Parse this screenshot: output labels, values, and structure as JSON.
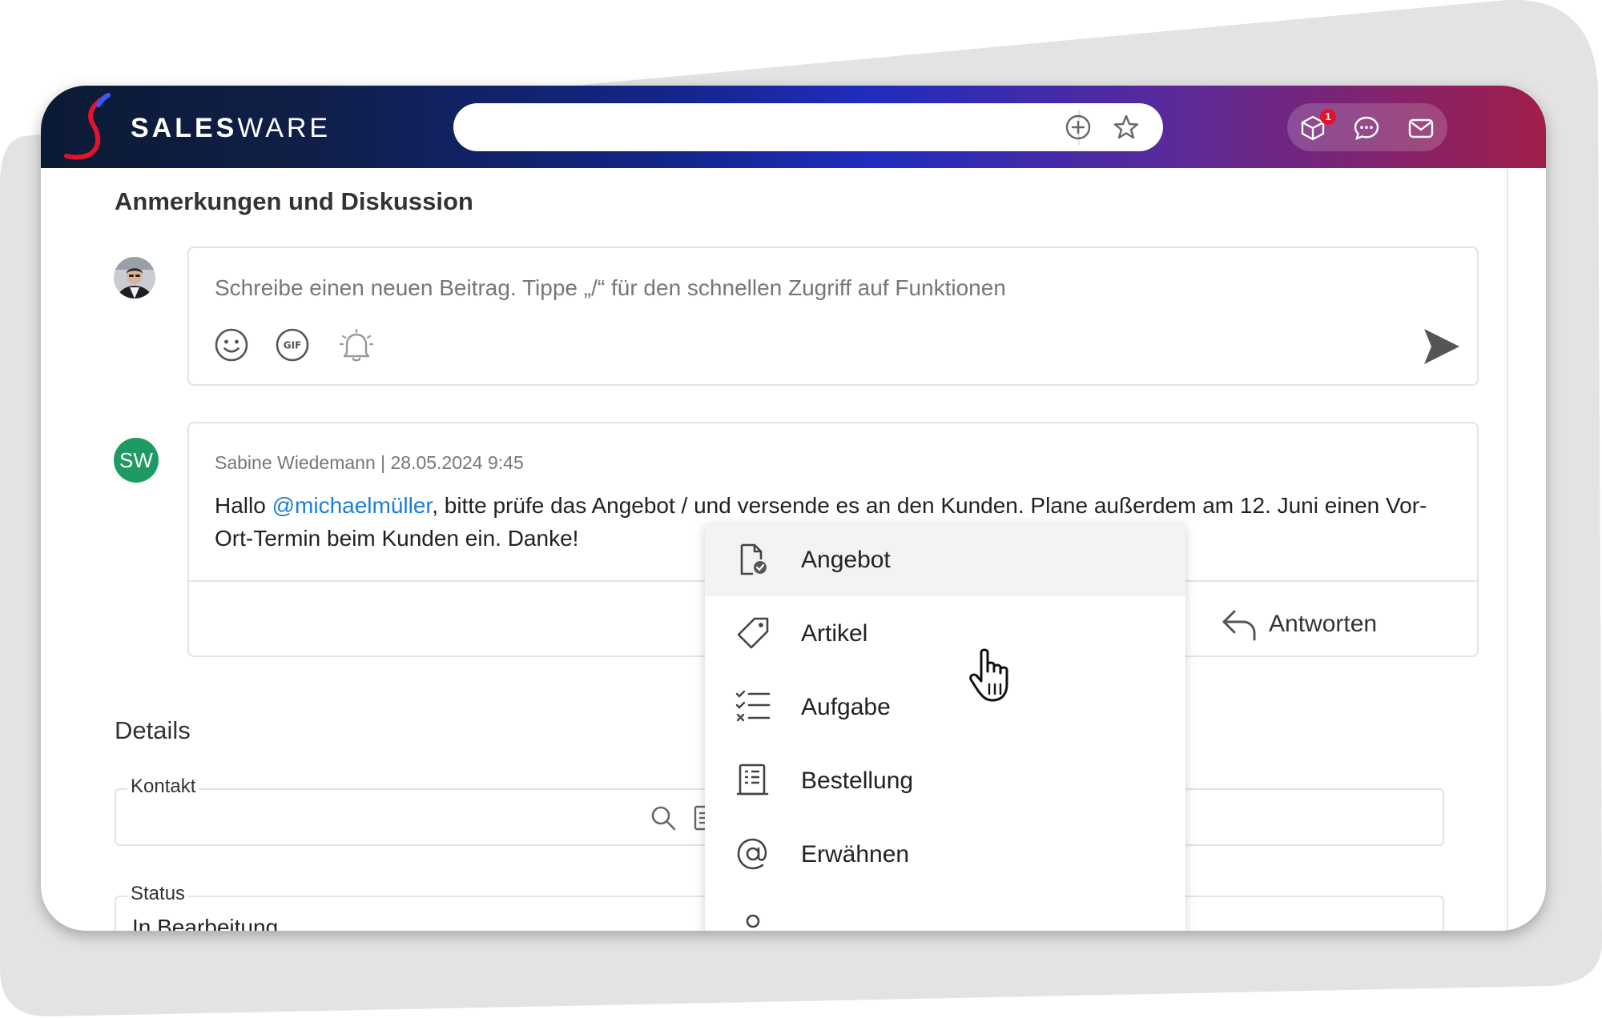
{
  "app": {
    "brand_bold": "SALES",
    "brand_light": "WARE"
  },
  "search": {
    "value": "",
    "placeholder": ""
  },
  "header_actions": {
    "notification_count": "1"
  },
  "discussion": {
    "title": "Anmerkungen und Diskussion",
    "composer_placeholder": "Schreibe einen neuen Beitrag. Tippe  „/“ für den schnellen Zugriff auf Funktionen"
  },
  "post": {
    "author_initials": "SW",
    "meta": "Sabine Wiedemann | 28.05.2024 9:45",
    "text_before": "Hallo ",
    "mention": "@michaelmüller",
    "text_after": ", bitte prüfe das Angebot / und versende es an den Kunden. Plane außerdem am 12. Juni einen Vor-Ort-Termin beim Kunden ein. Danke!",
    "reply_label": "Antworten"
  },
  "details": {
    "title": "Details",
    "contact_label": "Kontakt",
    "contact_value": "",
    "status_label": "Status",
    "status_value": "In Bearbeitung"
  },
  "slash_menu": {
    "items": [
      {
        "label": "Angebot",
        "icon": "document-check-icon"
      },
      {
        "label": "Artikel",
        "icon": "tag-icon"
      },
      {
        "label": "Aufgabe",
        "icon": "checklist-icon"
      },
      {
        "label": "Bestellung",
        "icon": "order-list-icon"
      },
      {
        "label": "Erwähnen",
        "icon": "at-sign-icon"
      }
    ],
    "hovered_index": 0
  },
  "colors": {
    "brand_red": "#e3132d",
    "mention_blue": "#1a7fd6",
    "avatar_green": "#1e9a63"
  }
}
